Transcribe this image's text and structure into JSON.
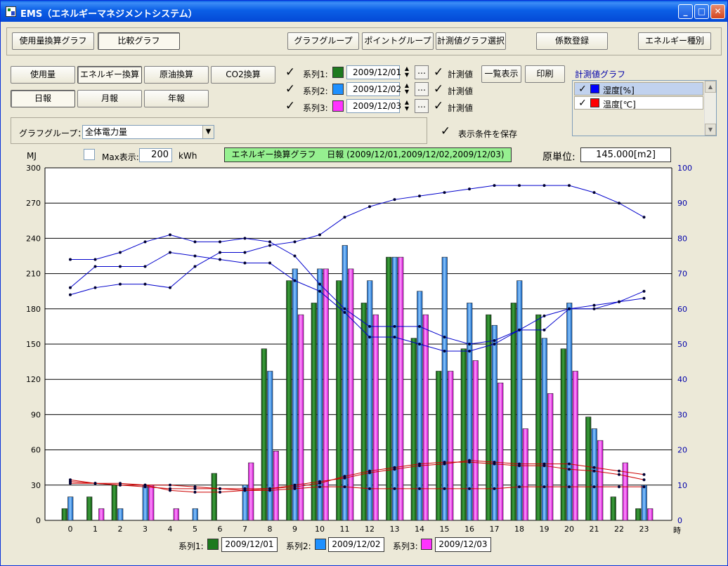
{
  "window": {
    "title": "EMS（エネルギーマネジメントシステム）"
  },
  "top_tabs": {
    "usage_graph": "使用量換算グラフ",
    "compare_graph": "比較グラフ"
  },
  "top_buttons": {
    "graph_group": "グラフグループ",
    "point_group": "ポイントグループ",
    "measure_select": "計測値グラフ選択",
    "coef_register": "係数登録",
    "energy_type": "エネルギー種別"
  },
  "mode_buttons": {
    "usage": "使用量",
    "energy": "エネルギー換算",
    "crude": "原油換算",
    "co2": "CO2換算"
  },
  "period_buttons": {
    "daily": "日報",
    "monthly": "月報",
    "yearly": "年報"
  },
  "series_rows": [
    {
      "label": "系列1:",
      "date": "2009/12/01",
      "measure_label": "計測値"
    },
    {
      "label": "系列2:",
      "date": "2009/12/02",
      "measure_label": "計測値"
    },
    {
      "label": "系列3:",
      "date": "2009/12/03",
      "measure_label": "計測値"
    }
  ],
  "action_buttons": {
    "list_view": "一覧表示",
    "print": "印刷",
    "dots": "…"
  },
  "measure_panel": {
    "title": "計測値グラフ",
    "items": [
      {
        "label": "湿度[%]"
      },
      {
        "label": "温度[℃]"
      }
    ]
  },
  "group": {
    "label": "グラフグループ：",
    "value": "全体電力量"
  },
  "save_conditions": "表示条件を保存",
  "chart_header": {
    "unit_left": "MJ",
    "max_label": "Max表示:",
    "max_value": "200",
    "max_unit": "kWh",
    "graph_title": "エネルギー換算グラフ　 日報 (2009/12/01,2009/12/02,2009/12/03)",
    "base_label": "原単位:",
    "base_value": "145.000[m2]"
  },
  "legend": [
    {
      "label": "系列1:",
      "value": "2009/12/01"
    },
    {
      "label": "系列2:",
      "value": "2009/12/02"
    },
    {
      "label": "系列3:",
      "value": "2009/12/03"
    }
  ],
  "colors": {
    "series1": "#1E7A1E",
    "series2": "#1E90FF",
    "series3": "#FF33FF",
    "humidity": "#0000CC",
    "temperature": "#CC0000",
    "title_green": "#96F090",
    "list_sel": "#C1D2EE"
  },
  "chart_data": {
    "type": "bar",
    "categories": [
      "0",
      "1",
      "2",
      "3",
      "4",
      "5",
      "6",
      "7",
      "8",
      "9",
      "10",
      "11",
      "12",
      "13",
      "14",
      "15",
      "16",
      "17",
      "18",
      "19",
      "20",
      "21",
      "22",
      "23"
    ],
    "xlabel": "時",
    "ylabel": "MJ",
    "ylim": [
      0,
      300
    ],
    "y2lim": [
      0,
      100
    ],
    "yticks": [
      "0",
      "30",
      "60",
      "90",
      "120",
      "150",
      "180",
      "210",
      "240",
      "270",
      "300"
    ],
    "y2ticks": [
      "0",
      "10",
      "20",
      "30",
      "40",
      "50",
      "60",
      "70",
      "80",
      "90",
      "100"
    ],
    "grid": true,
    "series": [
      {
        "name": "2009/12/01",
        "values": [
          10,
          20,
          30,
          0,
          0,
          0,
          40,
          0,
          146,
          204,
          185,
          204,
          185,
          224,
          155,
          127,
          146,
          175,
          185,
          175,
          146,
          88,
          20,
          10
        ]
      },
      {
        "name": "2009/12/02",
        "values": [
          20,
          0,
          10,
          30,
          0,
          10,
          0,
          30,
          127,
          214,
          214,
          234,
          204,
          224,
          195,
          224,
          185,
          166,
          204,
          155,
          185,
          78,
          0,
          30
        ]
      },
      {
        "name": "2009/12/03",
        "values": [
          0,
          10,
          0,
          30,
          10,
          0,
          0,
          49,
          59,
          175,
          214,
          214,
          175,
          224,
          175,
          127,
          136,
          117,
          78,
          108,
          127,
          68,
          49,
          10
        ]
      }
    ],
    "lines": [
      {
        "name": "湿度 2009/12/01",
        "axis": "right",
        "values": [
          74,
          74,
          76,
          79,
          81,
          79,
          79,
          80,
          79,
          75,
          67,
          60,
          55,
          55,
          55,
          52,
          50,
          51,
          54,
          54,
          60,
          61,
          62,
          63
        ]
      },
      {
        "name": "湿度 2009/12/02",
        "axis": "right",
        "values": [
          66,
          72,
          72,
          72,
          76,
          75,
          74,
          73,
          73,
          68,
          65,
          59,
          52,
          52,
          50,
          48,
          48,
          50,
          54,
          58,
          60,
          60,
          62,
          65
        ]
      },
      {
        "name": "湿度 2009/12/03",
        "axis": "right",
        "values": [
          64,
          66,
          67,
          67,
          66,
          72,
          76,
          76,
          78,
          79,
          81,
          86,
          89,
          91,
          92,
          93,
          94,
          95,
          95,
          95,
          95,
          93,
          90,
          86
        ]
      },
      {
        "name": "温度 2009/12/01",
        "axis": "right",
        "values": [
          11,
          10.5,
          10,
          10,
          10,
          9.5,
          9,
          9,
          9,
          9.5,
          10.5,
          12.5,
          14,
          15,
          16,
          16.5,
          16.5,
          16,
          15.5,
          15.5,
          14.5,
          14,
          13,
          11.5
        ]
      },
      {
        "name": "温度 2009/12/02",
        "axis": "right",
        "values": [
          10.5,
          10.5,
          10,
          9.5,
          9,
          9,
          9,
          8.5,
          8.5,
          9,
          9.5,
          9.5,
          9,
          9,
          9,
          9,
          9,
          9,
          9.5,
          9.5,
          9.5,
          9.5,
          9.5,
          9.5
        ]
      },
      {
        "name": "温度 2009/12/03",
        "axis": "right",
        "values": [
          11.5,
          10.5,
          10.5,
          10,
          8.5,
          8,
          8,
          8.5,
          9,
          10,
          11,
          12,
          13.5,
          14.5,
          15.5,
          16,
          17,
          16.5,
          16,
          16,
          16,
          15,
          14,
          13
        ]
      }
    ]
  }
}
